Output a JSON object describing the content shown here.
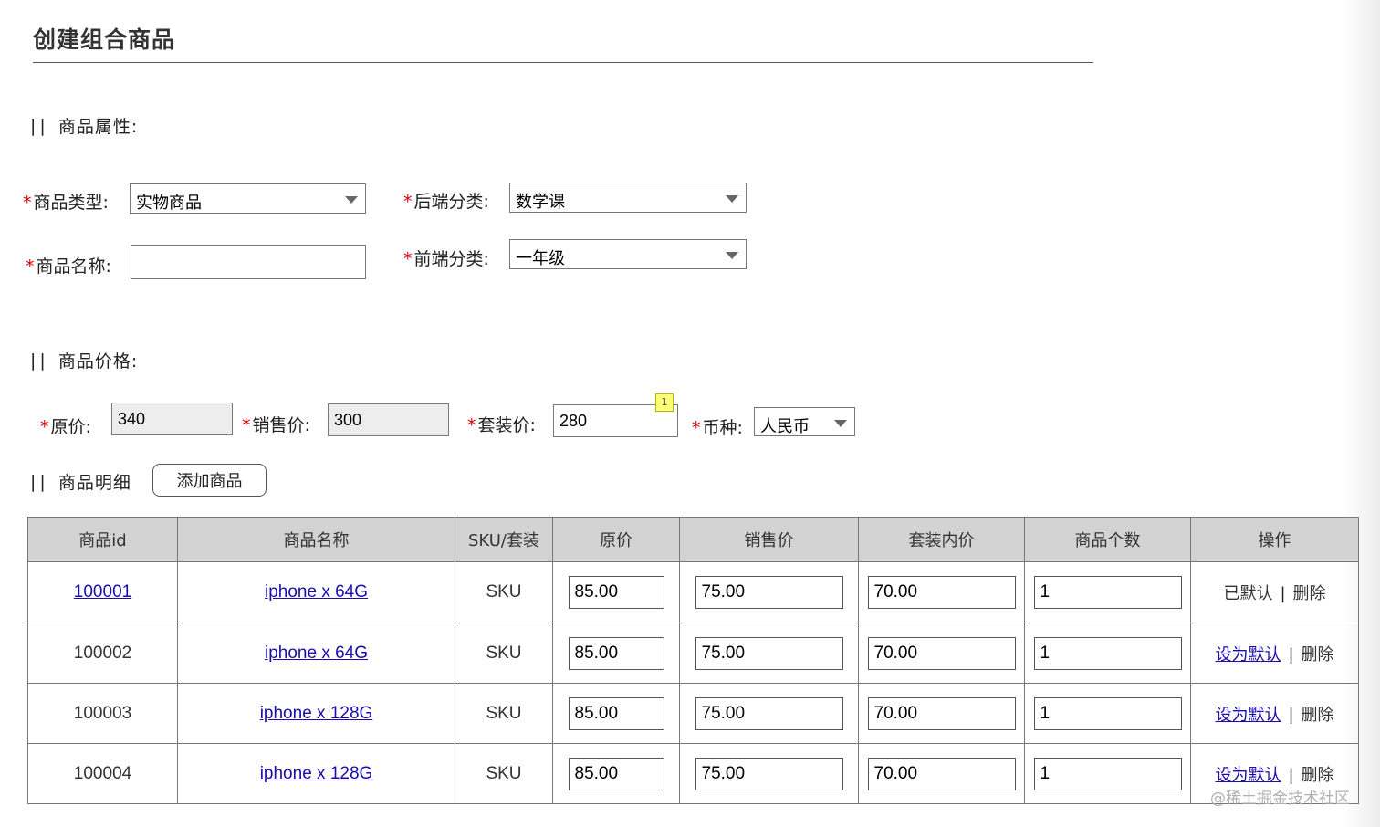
{
  "page": {
    "title": "创建组合商品"
  },
  "sections": {
    "attributes": "商品属性:",
    "price": "商品价格:",
    "details": "商品明细"
  },
  "bars": "||",
  "required_mark": "*",
  "attributes": {
    "type_label": "商品类型:",
    "type_value": "实物商品",
    "backend_label": "后端分类:",
    "backend_value": "数学课",
    "name_label": "商品名称:",
    "name_value": "",
    "frontend_label": "前端分类:",
    "frontend_value": "一年级"
  },
  "price": {
    "original_label": "原价:",
    "original_value": "340",
    "sale_label": "销售价:",
    "sale_value": "300",
    "bundle_label": "套装价:",
    "bundle_value": "280",
    "bundle_badge": "1",
    "currency_label": "币种:",
    "currency_value": "人民币"
  },
  "details": {
    "add_button": "添加商品",
    "columns": [
      "商品id",
      "商品名称",
      "SKU/套装",
      "原价",
      "销售价",
      "套装内价",
      "商品个数",
      "操作"
    ],
    "rows": [
      {
        "id": "100001",
        "name": "iphone x 64G",
        "sku": "SKU",
        "orig": "85.00",
        "sale": "75.00",
        "inner": "70.00",
        "qty": "1",
        "op_default": "已默认",
        "op_delete": "删除"
      },
      {
        "id": "100002",
        "name": "iphone x 64G",
        "sku": "SKU",
        "orig": "85.00",
        "sale": "75.00",
        "inner": "70.00",
        "qty": "1",
        "op_default": "设为默认",
        "op_delete": "删除"
      },
      {
        "id": "100003",
        "name": "iphone x 128G",
        "sku": "SKU",
        "orig": "85.00",
        "sale": "75.00",
        "inner": "70.00",
        "qty": "1",
        "op_default": "设为默认",
        "op_delete": "删除"
      },
      {
        "id": "100004",
        "name": "iphone x 128G",
        "sku": "SKU",
        "orig": "85.00",
        "sale": "75.00",
        "inner": "70.00",
        "qty": "1",
        "op_default": "设为默认",
        "op_delete": "删除"
      }
    ],
    "op_separator": "|"
  },
  "watermark": "@稀土掘金技术社区",
  "colors": {
    "required": "#d40000",
    "link": "#1a0dab",
    "header_bg": "#d3d3d3",
    "readonly_bg": "#ededed",
    "badge_bg": "#ffff77"
  }
}
